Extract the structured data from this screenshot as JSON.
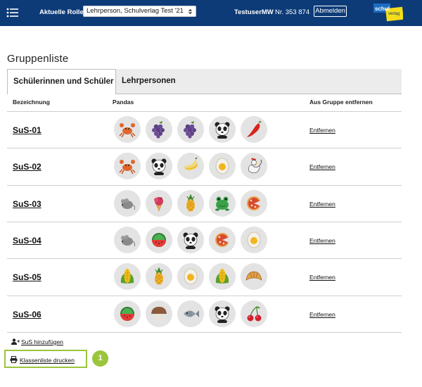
{
  "header": {
    "role_label": "Aktuelle Rolle",
    "role_selected": "Lehrperson, Schulverlag Test '21",
    "user": "TestuserMW",
    "number": "Nr. 353 874",
    "logout_label": "Abmelden",
    "logo_text_top": "schul",
    "logo_text_bottom": "verlag",
    "colors": {
      "bar": "#0d3b78",
      "logo_blue": "#1b6cc1",
      "logo_yellow": "#f5dd1a"
    }
  },
  "page_title": "Gruppenliste",
  "tabs": [
    {
      "label": "Schülerinnen und Schüler",
      "active": true
    },
    {
      "label": "Lehrpersonen",
      "active": false
    }
  ],
  "table": {
    "col_name": "Bezeichnung",
    "col_icons": "Pandas",
    "col_remove": "Aus Gruppe entfernen",
    "remove_label": "Entfernen",
    "rows": [
      {
        "name": "SuS-01",
        "icons": [
          "crab-icon",
          "grapes-icon",
          "grapes-icon",
          "panda-icon",
          "chili-icon"
        ]
      },
      {
        "name": "SuS-02",
        "icons": [
          "crab-icon",
          "panda-icon",
          "banana-icon",
          "egg-icon",
          "rooster-icon"
        ]
      },
      {
        "name": "SuS-03",
        "icons": [
          "mouse-icon",
          "ice-cream-icon",
          "pineapple-icon",
          "frog-icon",
          "pizza-icon"
        ]
      },
      {
        "name": "SuS-04",
        "icons": [
          "mouse-icon",
          "watermelon-icon",
          "panda-icon",
          "pizza-icon",
          "egg-icon"
        ]
      },
      {
        "name": "SuS-05",
        "icons": [
          "corn-icon",
          "pineapple-icon",
          "egg-icon",
          "corn-icon",
          "croissant-icon"
        ]
      },
      {
        "name": "SuS-06",
        "icons": [
          "watermelon-icon",
          "mushroom-icon",
          "fish-icon",
          "panda-icon",
          "cherries-icon"
        ]
      }
    ]
  },
  "actions": {
    "add_label": "SuS hinzufügen",
    "print_label": "Klassenliste drucken",
    "step_number": "1",
    "highlight_color": "#9bc53d"
  }
}
